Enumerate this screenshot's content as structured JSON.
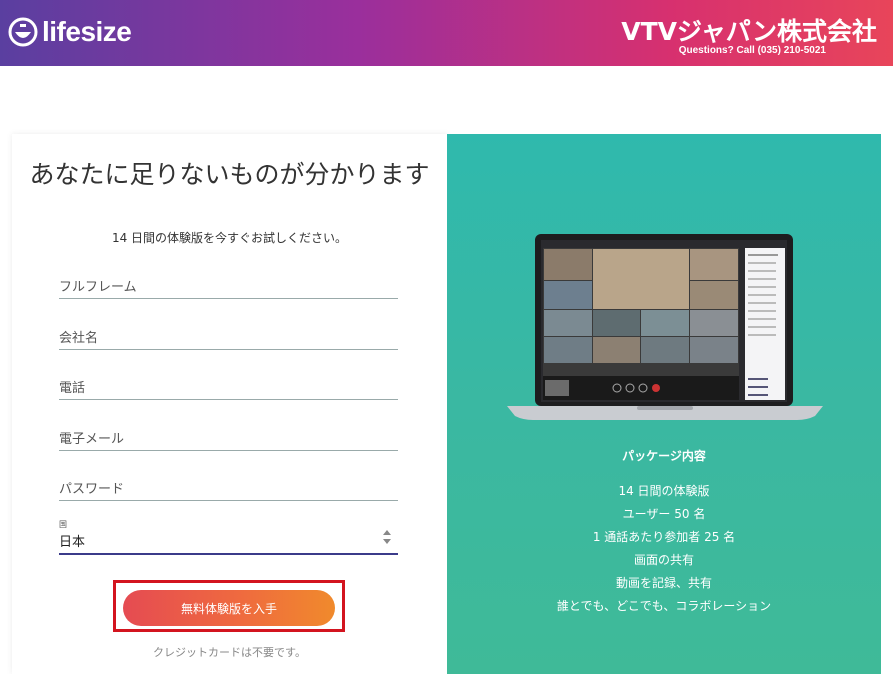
{
  "header": {
    "logo_text": "lifesize",
    "company": "VTVジャパン株式会社",
    "contact": "Questions? Call (035) 210-5021"
  },
  "form": {
    "title": "あなたに足りないものが分かります",
    "subtitle": "14 日間の体験版を今すぐお試しください。",
    "fields": {
      "fullname": "フルフレーム",
      "company": "会社名",
      "phone": "電話",
      "email": "電子メール",
      "password": "パスワード"
    },
    "country_label": "国",
    "country_value": "日本",
    "cta_label": "無料体験版を入手",
    "no_card": "クレジットカードは不要です。"
  },
  "promo": {
    "package_title": "パッケージ内容",
    "items": [
      "14 日間の体験版",
      "ユーザー 50 名",
      "1 通話あたり参加者 25 名",
      "画面の共有",
      "動画を記録、共有",
      "誰とでも、どこでも、コラボレーション"
    ]
  },
  "colors": {
    "header_start": "#5a3fa0",
    "header_end": "#e8455a",
    "promo_bg": "#34b9a6",
    "cta_start": "#e54b52",
    "cta_end": "#f08a2c",
    "highlight": "#d3141f"
  }
}
